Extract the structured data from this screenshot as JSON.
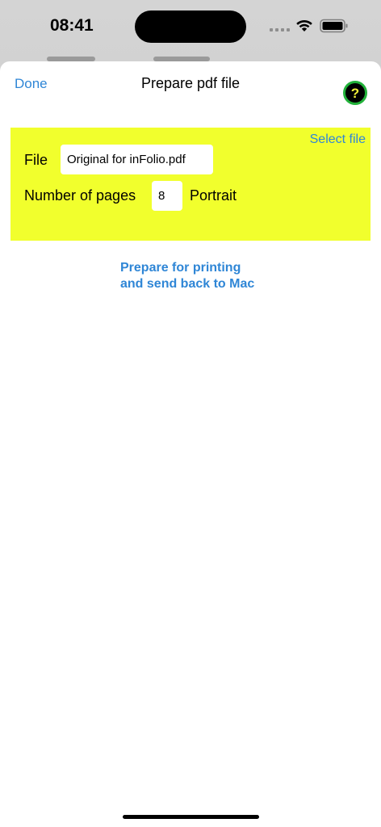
{
  "status_bar": {
    "time": "08:41"
  },
  "nav": {
    "done_label": "Done",
    "title": "Prepare pdf file",
    "help_label": "?"
  },
  "panel": {
    "select_file_label": "Select file",
    "file_label": "File",
    "file_value": "Original for inFolio.pdf",
    "pages_label": "Number of pages",
    "pages_value": "8",
    "orientation": "Portrait",
    "background_color": "#f1ff2d"
  },
  "action": {
    "line1": "Prepare for printing",
    "line2": "and send back to Mac"
  },
  "colors": {
    "accent": "#2f86d6",
    "help_ring": "#22b23a",
    "help_glyph": "#f2f23a"
  }
}
